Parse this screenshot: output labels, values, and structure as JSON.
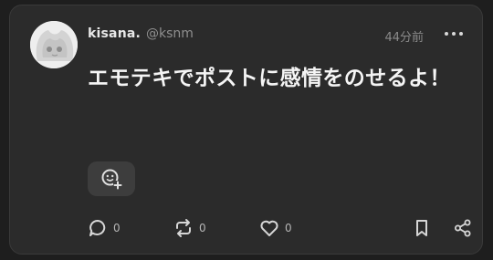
{
  "post": {
    "author_name": "kisana.",
    "author_handle": "@ksnm",
    "timestamp": "44分前",
    "text": "エモテキでポストに感情をのせるよ！"
  },
  "actions": {
    "reply_count": "0",
    "renote_count": "0",
    "like_count": "0"
  },
  "icons": {
    "more": "more-horizontal-icon",
    "reaction": "add-reaction-icon",
    "reply": "reply-icon",
    "renote": "renote-icon",
    "like": "heart-icon",
    "bookmark": "bookmark-icon",
    "share": "share-icon"
  },
  "colors": {
    "background": "#1e1e1e",
    "card": "#2b2b2b",
    "text": "#f5f5f5",
    "muted": "#8f8f8f"
  }
}
